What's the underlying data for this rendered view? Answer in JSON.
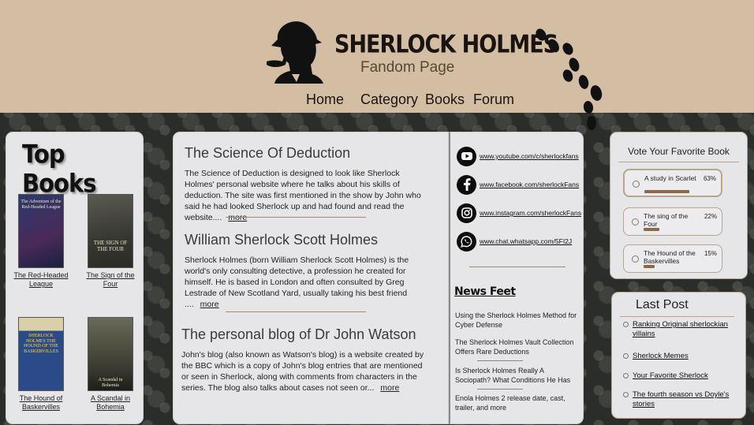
{
  "site": {
    "title": "SHERLOCK HOLMES",
    "subtitle": "Fandom Page"
  },
  "nav": {
    "items": [
      "Home",
      "Category",
      "Books",
      "Forum"
    ]
  },
  "top_books": {
    "title": "Top Books",
    "books": [
      {
        "label": "The Red-Headed League",
        "cover_text": "The Adventure of the Red-Headed League"
      },
      {
        "label": "The Sign of the Four",
        "cover_text": "THE SIGN OF THE FOUR"
      },
      {
        "label": "The Hound of Baskervilles",
        "cover_text": "SHERLOCK HOLMES THE HOUND OF THE BASKERVILLES"
      },
      {
        "label": "A Scandal in Bohemia",
        "cover_text": "A Scandal in Bohemia"
      }
    ]
  },
  "articles": [
    {
      "title": "The Science Of Deduction",
      "body": "The Science of Deduction is designed to look like Sherlock Holmes' personal website where he talks about his skills of deduction. The site was first mentioned in the show by John who said he had looked Sherlock up and had found and read the website....",
      "more": "more"
    },
    {
      "title": "William Sherlock Scott Holmes",
      "body": "Sherlock Holmes (born William Sherlock Scott Holmes) is the world's only consulting detective, a profession he created for himself. He is based in London and often consulted by Greg Lestrade of New Scotland Yard, usually taking his best friend ....",
      "more": "more"
    },
    {
      "title": "The personal blog of Dr John Watson",
      "body": "John's blog (also known as Watson's blog) is a website created by the BBC which is a copy of John's blog entries that are mentioned or seen in Sherlock, along with comments from characters in the series. The blog also talks about cases not seen or...",
      "more": "more"
    }
  ],
  "social": [
    {
      "icon": "youtube-icon",
      "url": "www.youtube.com/c/sherlockfans"
    },
    {
      "icon": "facebook-icon",
      "url": "www.facebook.com/sherlockFans"
    },
    {
      "icon": "instagram-icon",
      "url": "www.instagram.com/sherlockFans"
    },
    {
      "icon": "whatsapp-icon",
      "url": "www.chat.whatsapp.com/5FI2J"
    }
  ],
  "news": {
    "title": "News Feet",
    "items": [
      "Using the Sherlock Holmes Method for Cyber Defense",
      "The Sherlock Holmes Vault Collection Offers Rare Deductions",
      "Is Sherlock Holmes Really A Sociopath? What Conditions He Has",
      "Enola Holmes 2 release date, cast, trailer, and more"
    ]
  },
  "vote": {
    "title": "Vote Your Favorite Book",
    "options": [
      {
        "label": "A study in Scarlet",
        "percent": 63,
        "percent_label": "63%"
      },
      {
        "label": "The sing of the Four",
        "percent": 22,
        "percent_label": "22%"
      },
      {
        "label": "The Hound of the Baskervilles",
        "percent": 15,
        "percent_label": "15%"
      }
    ]
  },
  "last_post": {
    "title": "Last Post",
    "items": [
      "Ranking Original sherlockian villains",
      "Sherlock Memes",
      "Your Favorite Sherlock",
      "The fourth season vs Doyle's stories"
    ]
  },
  "colors": {
    "header_bg": "#d3bda3",
    "panel_bg": "#e6e6e8",
    "accent_brown": "#8a6a4a",
    "border_tan": "#b9a58a"
  }
}
